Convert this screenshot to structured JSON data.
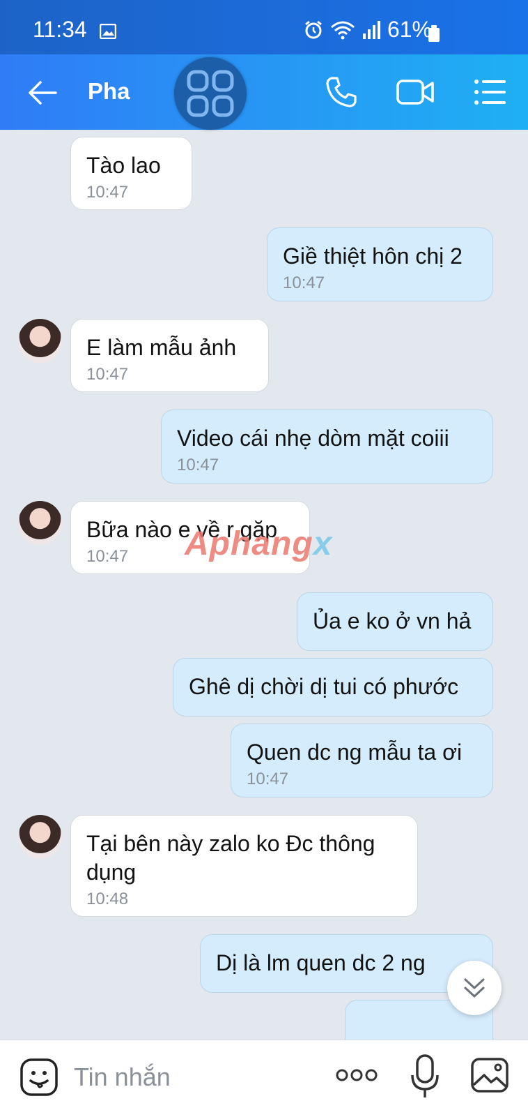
{
  "status_bar": {
    "time": "11:34",
    "battery": "61%"
  },
  "header": {
    "contact_name": "Pha"
  },
  "messages": [
    {
      "dir": "in",
      "text": "Tào lao",
      "time": "10:47"
    },
    {
      "dir": "out",
      "text": "Giề thiệt hôn chị 2",
      "time": "10:47"
    },
    {
      "dir": "in",
      "text": "E làm mẫu ảnh",
      "time": "10:47"
    },
    {
      "dir": "out",
      "text": "Video cái nhẹ dòm mặt coiii",
      "time": "10:47"
    },
    {
      "dir": "in",
      "text": "Bữa nào e về r gặp",
      "time": "10:47"
    },
    {
      "dir": "out",
      "text": "Ủa e ko ở vn hả",
      "time": ""
    },
    {
      "dir": "out",
      "text": "Ghê dị chời dị tui có phước",
      "time": ""
    },
    {
      "dir": "out",
      "text": "Quen dc ng mẫu ta ơi",
      "time": "10:47"
    },
    {
      "dir": "in",
      "text": "Tại bên này zalo ko Đc thông dụng",
      "time": "10:48"
    },
    {
      "dir": "out",
      "text": "Dị là lm quen dc 2 ng",
      "time": ""
    }
  ],
  "watermark": {
    "main": "Aphang",
    "suffix": "x"
  },
  "input_bar": {
    "placeholder": "Tin nhắn"
  },
  "icons": {
    "back": "arrow-left-icon",
    "apps": "apps-grid-icon",
    "call": "phone-icon",
    "video": "video-camera-icon",
    "menu": "list-menu-icon",
    "sticker": "sticker-face-icon",
    "more": "more-dots-icon",
    "mic": "microphone-icon",
    "image": "image-icon",
    "scroll": "chevron-double-down-icon"
  },
  "colors": {
    "header_start": "#2f7cf6",
    "header_end": "#1fb0f3",
    "outgoing_bubble": "#d5ecfc",
    "chat_bg": "#e3e8ef"
  }
}
